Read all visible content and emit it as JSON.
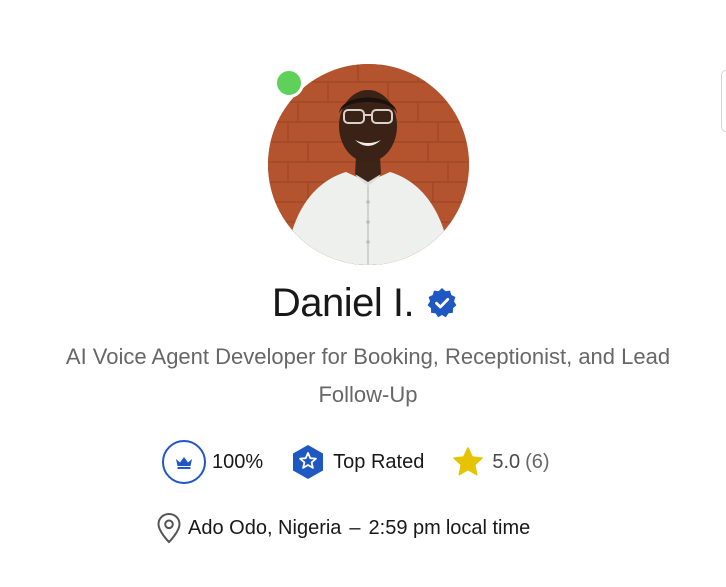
{
  "profile": {
    "name": "Daniel I.",
    "title": "AI Voice Agent Developer for Booking, Receptionist, and Lead Follow-Up",
    "online": true,
    "verified": true
  },
  "stats": {
    "job_success": "100%",
    "top_rated_label": "Top Rated",
    "rating": "5.0",
    "review_count": "(6)"
  },
  "location": {
    "place": "Ado Odo, Nigeria",
    "separator": "–",
    "time": "2:59 pm",
    "time_suffix": "local time"
  },
  "colors": {
    "online": "#5fd05a",
    "verified": "#1f57c3",
    "star": "#e5c300",
    "text": "#181818",
    "muted": "#676767"
  },
  "icons": {
    "verified": "verified-badge-icon",
    "job_success": "crown-icon",
    "top_rated": "top-rated-shield-icon",
    "rating": "star-icon",
    "location": "location-pin-icon"
  }
}
